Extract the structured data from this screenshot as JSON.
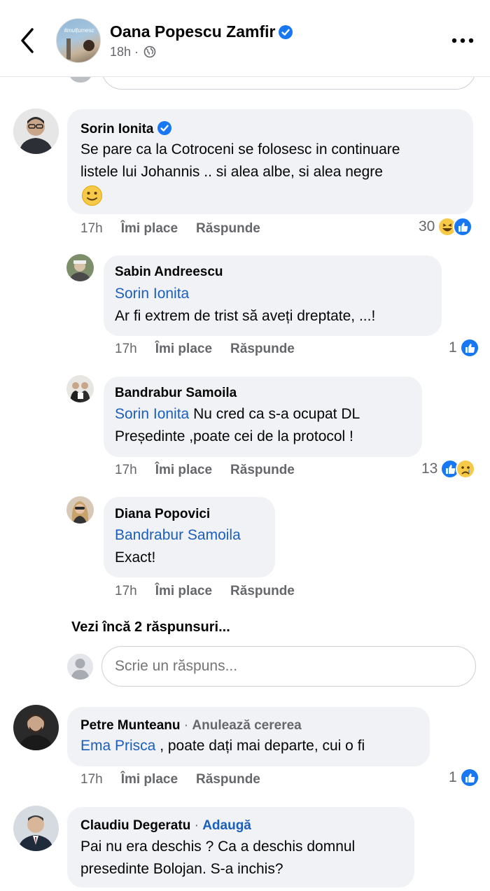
{
  "header": {
    "page_name": "Oana Popescu Zamfir",
    "time": "18h",
    "separator": " · ",
    "avatar_text": "#mulțumesc"
  },
  "comments": [
    {
      "author": "Sorin Ionita",
      "line1": "Se pare ca la Cotroceni se folosesc in continuare",
      "line2": "listele lui Johannis .. si alea albe, si alea negre",
      "time": "17h",
      "like": "Îmi place",
      "reply": "Răspunde",
      "reactions": "30"
    },
    {
      "author": "Sabin Andreescu",
      "mention": "Sorin Ionita",
      "line1": "Ar fi extrem de trist să aveți dreptate, ...!",
      "time": "17h",
      "like": "Îmi place",
      "reply": "Răspunde",
      "reactions": "1"
    },
    {
      "author": "Bandrabur Samoila",
      "mention": "Sorin Ionita",
      "line1": " Nu cred ca s-a ocupat DL",
      "line2": "Președinte ,poate cei de la protocol !",
      "time": "17h",
      "like": "Îmi place",
      "reply": "Răspunde",
      "reactions": "13"
    },
    {
      "author": "Diana Popovici",
      "mention": "Bandrabur Samoila",
      "line1": "Exact!",
      "time": "17h",
      "like": "Îmi place",
      "reply": "Răspunde"
    },
    {
      "author": "Petre Munteanu",
      "author_action": "Anulează cererea",
      "mention": "Ema Prisca",
      "line1": " , poate dați mai departe, cui o fi",
      "time": "17h",
      "like": "Îmi place",
      "reply": "Răspunde",
      "reactions": "1"
    },
    {
      "author": "Claudiu Degeratu",
      "author_action": "Adaugă",
      "line1": "Pai nu era deschis ? Ca a deschis domnul",
      "line2": "presedinte Bolojan. S-a inchis?"
    }
  ],
  "more_replies": "Vezi încă 2 răspunsuri...",
  "reply_input": {
    "placeholder": "Scrie un răspuns..."
  },
  "dot": " · "
}
